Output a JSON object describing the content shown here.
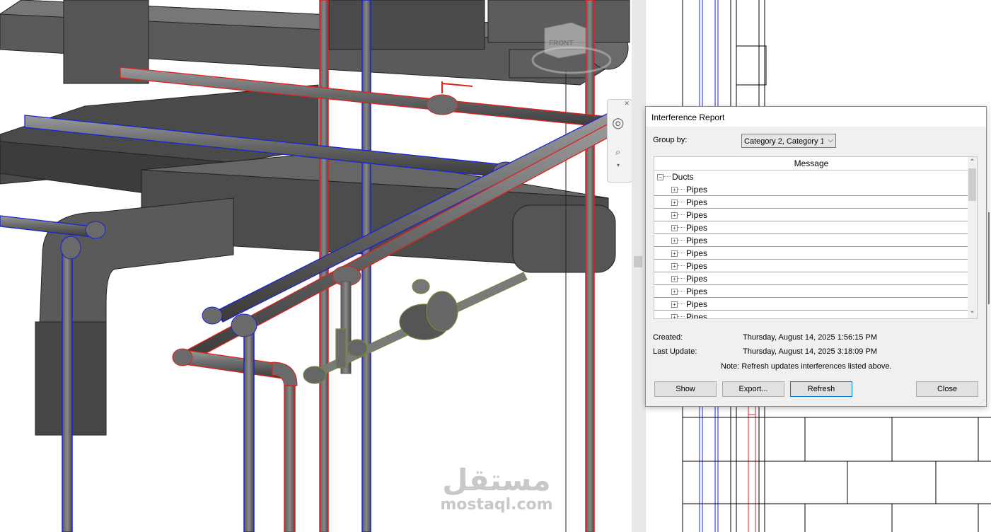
{
  "watermark": {
    "arabic": "مستقل",
    "latin": "mostaql.com"
  },
  "viewcube": {
    "face_label": "FRONT"
  },
  "dialog": {
    "title": "Interference Report",
    "group_by_label": "Group by:",
    "group_by_value": "Category 2, Category 1",
    "column_header": "Message",
    "tree": {
      "root_label": "Ducts",
      "children": [
        "Pipes",
        "Pipes",
        "Pipes",
        "Pipes",
        "Pipes",
        "Pipes",
        "Pipes",
        "Pipes",
        "Pipes",
        "Pipes",
        "Pipes"
      ]
    },
    "created_label": "Created:",
    "created_value": "Thursday, August 14, 2025 1:56:15 PM",
    "updated_label": "Last Update:",
    "updated_value": "Thursday, August 14, 2025 3:18:09 PM",
    "note": "Note: Refresh updates interferences listed above.",
    "buttons": {
      "show": "Show",
      "export": "Export...",
      "refresh": "Refresh",
      "close": "Close"
    }
  },
  "colors": {
    "highlight_red": "#e0201a",
    "highlight_blue": "#1a22d8",
    "selection_green": "#6f8a3e",
    "dialog_bg": "#f0f0f0"
  }
}
